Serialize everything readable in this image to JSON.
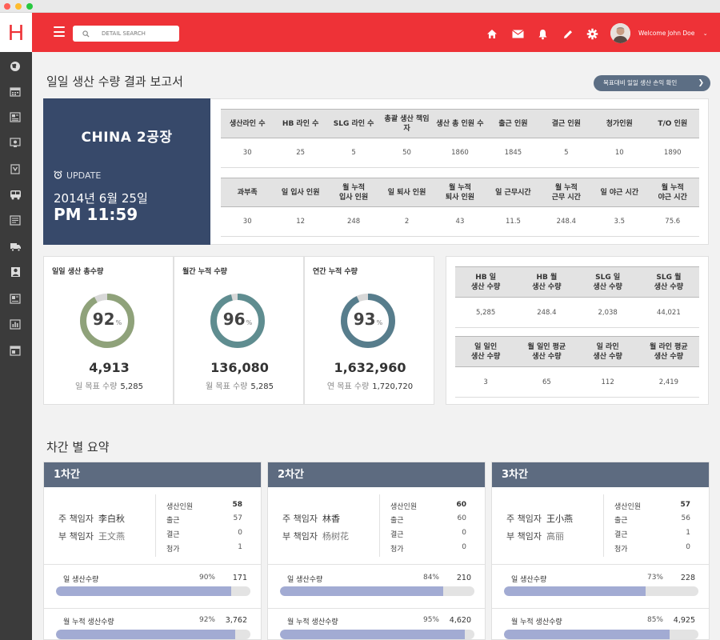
{
  "window": {
    "dots": [
      "#ff5f57",
      "#febc2e",
      "#28c840"
    ]
  },
  "colors": {
    "brand": "#ee3237",
    "sidebar": "#3b3b3b",
    "factory_panel": "#37496a",
    "card_header": "#5d6b80",
    "ring_green": "#8fa27a",
    "ring_teal": "#5f8d90",
    "ring_blue": "#577d8c",
    "ring_track": "#d8d8d8",
    "bar_fill": "#a2abd3"
  },
  "topbar": {
    "logo_letter": "H",
    "search_placeholder": "DETAIL SEARCH",
    "icons": [
      "home-icon",
      "mail-icon",
      "bell-icon",
      "pencil-icon",
      "gear-icon"
    ],
    "welcome": "Welcome John Doe"
  },
  "sidebar": {
    "icons": [
      "globe-icon",
      "calendar-icon",
      "document-icon",
      "monitor-icon",
      "schedule-icon",
      "bus-icon",
      "report-icon",
      "truck-icon",
      "person-icon",
      "chart-icon",
      "bar-chart-icon",
      "window-icon"
    ]
  },
  "report": {
    "title": "일일 생산 수량 결과 보고서",
    "loss_button": "목표대비 일일 생산 손익 확인"
  },
  "factory": {
    "name": "CHINA 2공장",
    "update_label": "UPDATE",
    "date": "2014년 6월 25일",
    "time": "PM 11:59"
  },
  "staff_table1": {
    "headers": [
      "생산라인 수",
      "HB 라인 수",
      "SLG 라인 수",
      "총괄 생산 책임자",
      "생산 총 인원 수",
      "출근 인원",
      "결근 인원",
      "청가인원",
      "T/O 인원"
    ],
    "values": [
      "30",
      "25",
      "5",
      "50",
      "1860",
      "1845",
      "5",
      "10",
      "1890"
    ]
  },
  "staff_table2": {
    "headers": [
      "과부족",
      "일 입사 인원",
      "월 누적\n입사 인원",
      "일 퇴사 인원",
      "월 누적\n퇴사 인원",
      "일 근무시간",
      "월 누적\n근무 시간",
      "일 야근 시간",
      "월 누적\n야근 시간"
    ],
    "values": [
      "30",
      "12",
      "248",
      "2",
      "43",
      "11.5",
      "248.4",
      "3.5",
      "75.6"
    ]
  },
  "kpis": [
    {
      "title": "일일 생산 총수량",
      "percent": 92,
      "pct_sign": "%",
      "value": "4,913",
      "goal_label": "일 목표 수량",
      "goal_value": "5,285"
    },
    {
      "title": "월간 누적 수량",
      "percent": 96,
      "pct_sign": "%",
      "value": "136,080",
      "goal_label": "월 목표 수량",
      "goal_value": "5,285"
    },
    {
      "title": "연간 누적 수량",
      "percent": 93,
      "pct_sign": "%",
      "value": "1,632,960",
      "goal_label": "연 목표 수량",
      "goal_value": "1,720,720"
    }
  ],
  "prod_table1": {
    "headers": [
      "HB 일\n생산 수량",
      "HB 월\n생산 수량",
      "SLG 일\n생산 수량",
      "SLG 월\n생산 수량"
    ],
    "values": [
      "5,285",
      "248.4",
      "2,038",
      "44,021"
    ]
  },
  "prod_table2": {
    "headers": [
      "일 일인\n생산 수량",
      "월 일인 평균\n생산 수량",
      "일 라인\n생산 수량",
      "월 라인 평균\n생산 수량"
    ],
    "values": [
      "3",
      "65",
      "112",
      "2,419"
    ]
  },
  "shift_summary": {
    "title": "차간 별 요약",
    "shifts": [
      {
        "name": "1차간",
        "main_label": "주 책임자",
        "main_name": "李白秋",
        "sub_label": "부 책임자",
        "sub_name": "王文燕",
        "stats": [
          {
            "label": "생산인원",
            "value": "58"
          },
          {
            "label": "출근",
            "value": "57"
          },
          {
            "label": "결근",
            "value": "0"
          },
          {
            "label": "청가",
            "value": "1"
          }
        ],
        "bars": [
          {
            "label": "일 생산수량",
            "percent_text": "90%",
            "value": "171",
            "fraction": 0.9
          },
          {
            "label": "월 누적 생산수량",
            "percent_text": "92%",
            "value": "3,762",
            "fraction": 0.92
          }
        ]
      },
      {
        "name": "2차간",
        "main_label": "주 책임자",
        "main_name": "林香",
        "sub_label": "부 책임자",
        "sub_name": "杨树花",
        "stats": [
          {
            "label": "생산인원",
            "value": "60"
          },
          {
            "label": "출근",
            "value": "60"
          },
          {
            "label": "결근",
            "value": "0"
          },
          {
            "label": "청가",
            "value": "0"
          }
        ],
        "bars": [
          {
            "label": "일 생산수량",
            "percent_text": "84%",
            "value": "210",
            "fraction": 0.84
          },
          {
            "label": "월 누적 생산수량",
            "percent_text": "95%",
            "value": "4,620",
            "fraction": 0.95
          }
        ]
      },
      {
        "name": "3차간",
        "main_label": "주 책임자",
        "main_name": "王小燕",
        "sub_label": "부 책임자",
        "sub_name": "高丽",
        "stats": [
          {
            "label": "생산인원",
            "value": "57"
          },
          {
            "label": "출근",
            "value": "56"
          },
          {
            "label": "결근",
            "value": "1"
          },
          {
            "label": "청가",
            "value": "0"
          }
        ],
        "bars": [
          {
            "label": "일 생산수량",
            "percent_text": "73%",
            "value": "228",
            "fraction": 0.73
          },
          {
            "label": "월 누적 생산수량",
            "percent_text": "85%",
            "value": "4,925",
            "fraction": 0.85
          }
        ]
      }
    ]
  }
}
